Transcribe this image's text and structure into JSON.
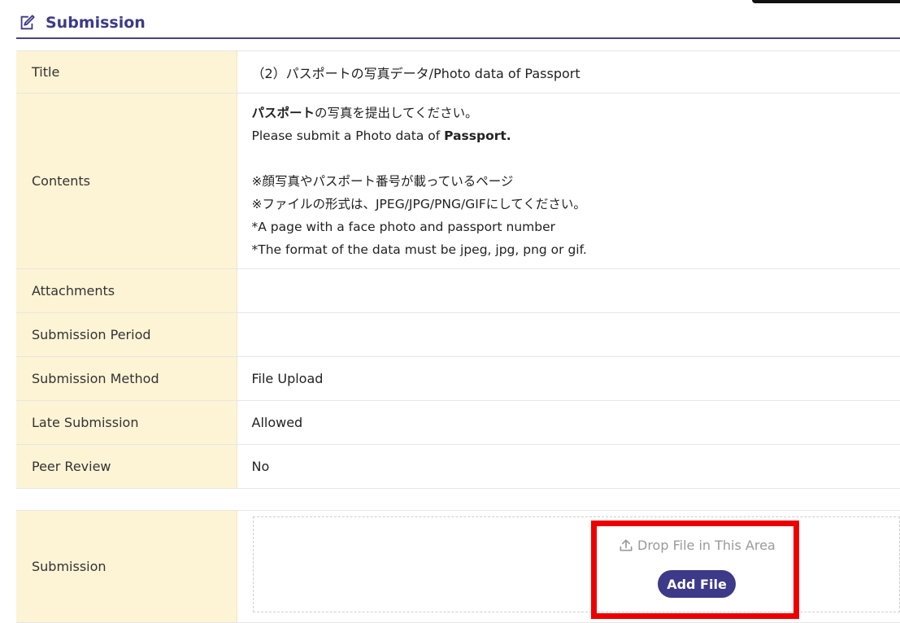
{
  "header": {
    "title": "Submission",
    "icon": "edit-icon",
    "accent": "#3d3a8a"
  },
  "info_rows": [
    {
      "label": "Title",
      "value": "（2）パスポートの写真データ/Photo data of Passport"
    },
    {
      "label": "Contents"
    },
    {
      "label": "Attachments",
      "value": ""
    },
    {
      "label": "Submission Period",
      "value": ""
    },
    {
      "label": "Submission Method",
      "value": "File Upload"
    },
    {
      "label": "Late Submission",
      "value": "Allowed"
    },
    {
      "label": "Peer Review",
      "value": "No"
    }
  ],
  "contents": {
    "line1_bold": "パスポート",
    "line1_rest": "の写真を提出してください。",
    "line2_pre": "Please submit a Photo data of ",
    "line2_bold": "Passport.",
    "line3": "※顔写真やパスポート番号が載っているページ",
    "line4": "※ファイルの形式は、JPEG/JPG/PNG/GIFにしてください。",
    "line5": "*A page with a face photo and passport number",
    "line6": "*The format of the data must be jpeg, jpg, png or gif."
  },
  "submission": {
    "label": "Submission",
    "drop_text": "Drop File in This Area",
    "add_file_label": "Add File",
    "upload_icon": "upload-icon"
  },
  "colors": {
    "label_bg": "#fdf3d5",
    "button_bg": "#3d3a8a",
    "highlight": "#ee0000"
  }
}
